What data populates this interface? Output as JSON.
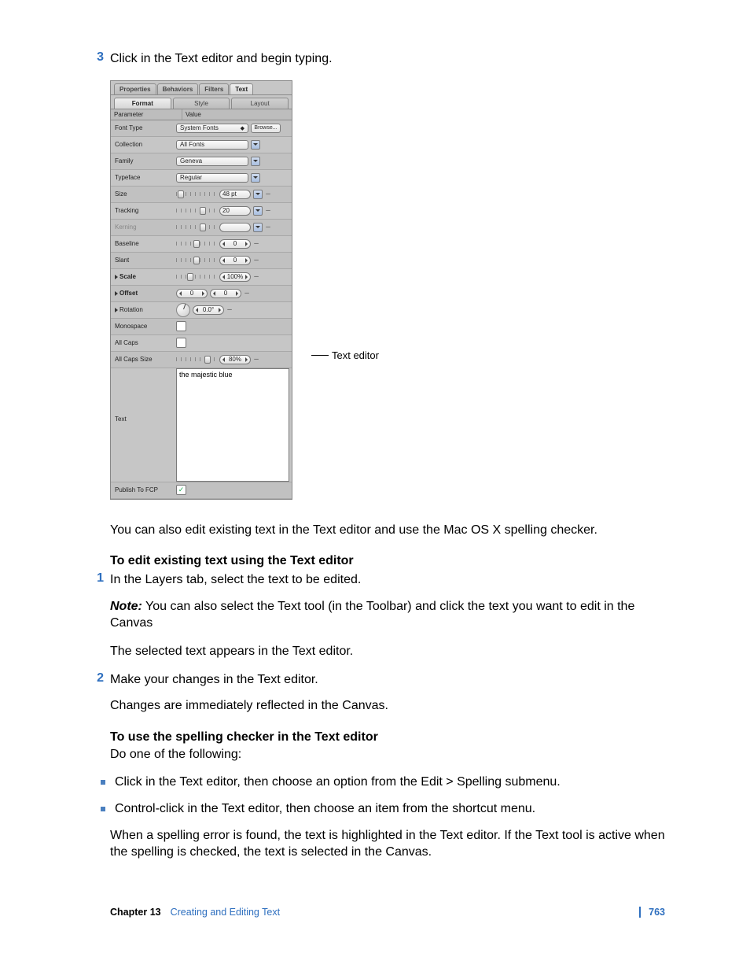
{
  "step3": {
    "num": "3",
    "text": "Click in the Text editor and begin typing."
  },
  "inspector": {
    "tabs": [
      "Properties",
      "Behaviors",
      "Filters",
      "Text"
    ],
    "subtabs": [
      "Format",
      "Style",
      "Layout"
    ],
    "header": {
      "left": "Parameter",
      "right": "Value"
    },
    "fontType": {
      "label": "Font Type",
      "dropdown": "System Fonts",
      "browse": "Browse..."
    },
    "collection": {
      "label": "Collection",
      "value": "All Fonts"
    },
    "family": {
      "label": "Family",
      "value": "Geneva"
    },
    "typeface": {
      "label": "Typeface",
      "value": "Regular"
    },
    "size": {
      "label": "Size",
      "value": "48 pt"
    },
    "tracking": {
      "label": "Tracking",
      "value": "20"
    },
    "kerning": {
      "label": "Kerning",
      "value": ""
    },
    "baseline": {
      "label": "Baseline",
      "value": "0"
    },
    "slant": {
      "label": "Slant",
      "value": "0"
    },
    "scale": {
      "label": "Scale",
      "value": "100%"
    },
    "offset": {
      "label": "Offset",
      "x": "0",
      "y": "0"
    },
    "rotation": {
      "label": "Rotation",
      "value": "0.0°"
    },
    "monospace": {
      "label": "Monospace"
    },
    "allCaps": {
      "label": "All Caps"
    },
    "allCapsSize": {
      "label": "All Caps Size",
      "value": "80%"
    },
    "text": {
      "label": "Text",
      "value": "the majestic blue"
    },
    "publish": {
      "label": "Publish To FCP"
    }
  },
  "callout": "Text editor",
  "afterFigure": "You can also edit existing text in the Text editor and use the Mac OS X spelling checker.",
  "heading1": "To edit existing text using the Text editor",
  "step1b": {
    "num": "1",
    "text": "In the Layers tab, select the text to be edited."
  },
  "note": {
    "word": "Note:",
    "text": "  You can also select the Text tool (in the Toolbar) and click the text you want to edit in the Canvas"
  },
  "selectedAppears": "The selected text appears in the Text editor.",
  "step2b": {
    "num": "2",
    "text": "Make your changes in the Text editor."
  },
  "changesReflect": "Changes are immediately reflected in the Canvas.",
  "heading2": "To use the spelling checker in the Text editor",
  "doOne": "Do one of the following:",
  "bullet1": "Click in the Text editor, then choose an option from the Edit > Spelling submenu.",
  "bullet2": "Control-click in the Text editor, then choose an item from the shortcut menu.",
  "spellFound": "When a spelling error is found, the text is highlighted in the Text editor. If the Text tool is active when the spelling is checked, the text is selected in the Canvas.",
  "footer": {
    "chapter": "Chapter 13",
    "title": "Creating and Editing Text",
    "page": "763"
  }
}
